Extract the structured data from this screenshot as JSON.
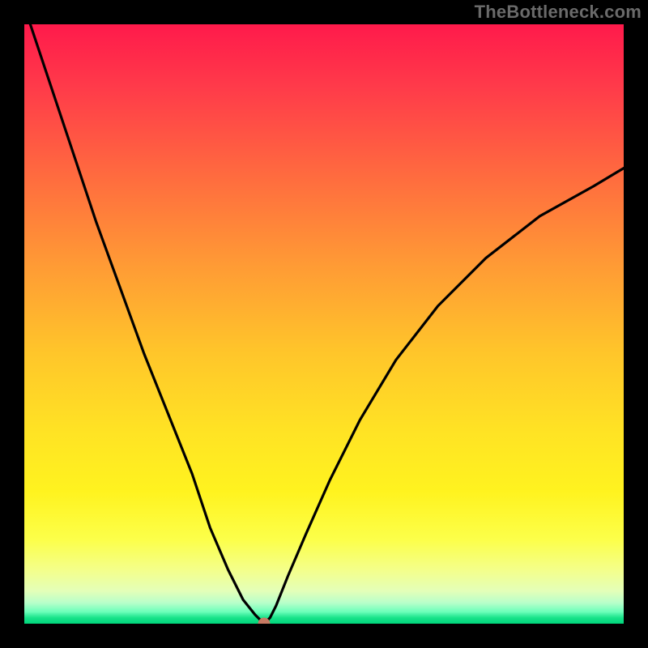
{
  "watermark": "TheBottleneck.com",
  "chart_data": {
    "type": "line",
    "title": "",
    "xlabel": "",
    "ylabel": "",
    "xlim": [
      0,
      100
    ],
    "ylim": [
      0,
      100
    ],
    "grid": false,
    "legend": false,
    "gradient_stops": [
      {
        "pos": 0,
        "color": "#ff1a4b"
      },
      {
        "pos": 25,
        "color": "#ff6a3f"
      },
      {
        "pos": 55,
        "color": "#ffc62a"
      },
      {
        "pos": 78,
        "color": "#fff31f"
      },
      {
        "pos": 92,
        "color": "#f4ff8a"
      },
      {
        "pos": 98,
        "color": "#6dffba"
      },
      {
        "pos": 100,
        "color": "#00d47a"
      }
    ],
    "series": [
      {
        "name": "bottleneck-curve",
        "x": [
          0,
          4,
          8,
          12,
          16,
          20,
          24,
          28,
          31,
          34,
          36.5,
          38.5,
          39.7,
          40.3,
          41,
          42,
          44,
          47,
          51,
          56,
          62,
          69,
          77,
          86,
          95,
          100
        ],
        "y": [
          103,
          91,
          79,
          67,
          56,
          45,
          35,
          25,
          16,
          9,
          4,
          1.5,
          0.3,
          0.3,
          1,
          3,
          8,
          15,
          24,
          34,
          44,
          53,
          61,
          68,
          73,
          76
        ]
      }
    ],
    "marker": {
      "x": 40,
      "y": 0,
      "color": "#c77a63"
    }
  }
}
